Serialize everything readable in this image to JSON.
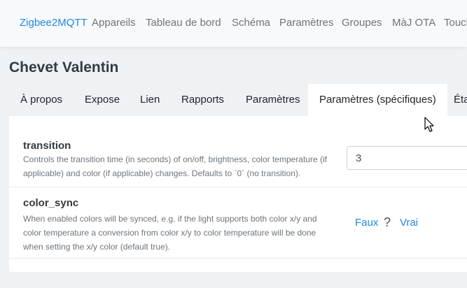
{
  "navbar": {
    "brand": "Zigbee2MQTT",
    "items": [
      "Appareils",
      "Tableau de bord",
      "Schéma",
      "Paramètres",
      "Groupes",
      "MàJ OTA",
      "Touch"
    ]
  },
  "device": {
    "title": "Chevet Valentin"
  },
  "tabs": [
    "À propos",
    "Expose",
    "Lien",
    "Rapports",
    "Paramètres",
    "Paramètres (spécifiques)",
    "Éta"
  ],
  "active_tab": "Paramètres (spécifiques)",
  "settings": [
    {
      "name": "transition",
      "description": "Controls the transition time (in seconds) of on/off, brightness, color temperature (if applicable) and color (if applicable) changes. Defaults to `0` (no transition).",
      "value": "3"
    },
    {
      "name": "color_sync",
      "description": "When enabled colors will be synced, e.g. if the light supports both color x/y and color temperature a conversion from color x/y to color temperature will be done when setting the x/y color (default true).",
      "off_label": "Faux",
      "state_symbol": "?",
      "on_label": "Vrai"
    }
  ]
}
